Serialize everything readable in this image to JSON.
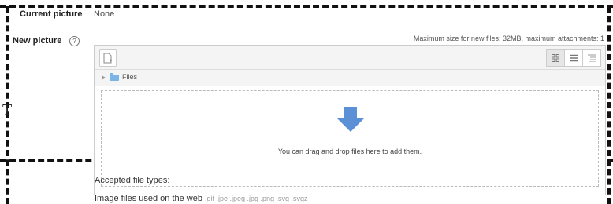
{
  "current_picture": {
    "label": "Current picture",
    "value": "None"
  },
  "new_picture": {
    "label": "New picture",
    "help_icon": "question-circle-icon",
    "help_glyph": "?"
  },
  "max_size_text": "Maximum size for new files: 32MB, maximum attachments: 1",
  "filepicker": {
    "add_icon": "add-file-icon",
    "views": [
      "icons-view-icon",
      "list-view-icon",
      "tree-view-icon"
    ],
    "path": {
      "folder_icon": "folder-icon",
      "label": "Files"
    },
    "dropzone": {
      "arrow_icon": "download-arrow-icon",
      "arrow_color": "#5b8fd6",
      "text": "You can drag and drop files here to add them."
    }
  },
  "accepted_types": {
    "heading": "Accepted file types:",
    "group_name": "Image files used on the web",
    "extensions": ".gif .jpe .jpeg .jpg .png .svg .svgz"
  },
  "page_glyph": "T"
}
